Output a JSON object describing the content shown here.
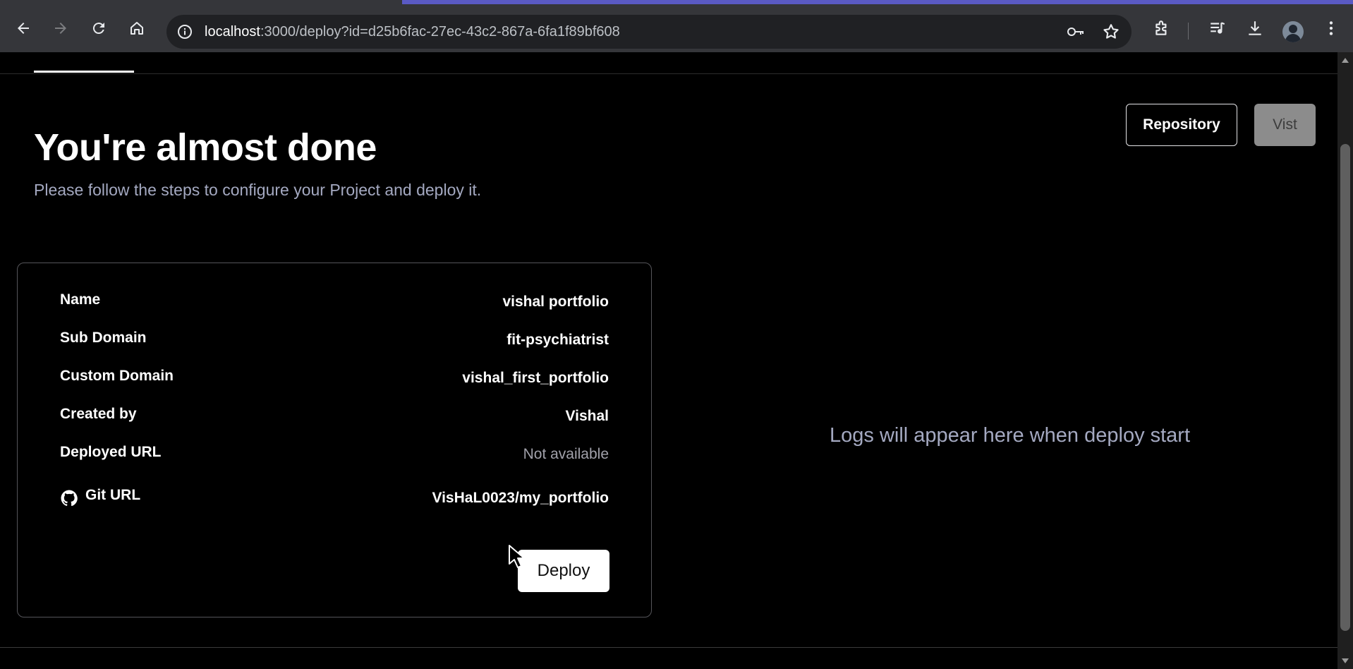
{
  "browser": {
    "url_host": "localhost",
    "url_rest": ":3000/deploy?id=d25b6fac-27ec-43c2-867a-6fa1f89bf608",
    "icons": [
      "back-arrow-icon",
      "forward-arrow-icon",
      "reload-icon",
      "home-icon",
      "site-info-icon",
      "password-key-icon",
      "bookmark-star-icon",
      "extensions-puzzle-icon",
      "media-queue-icon",
      "download-icon",
      "profile-avatar",
      "more-menu-icon"
    ]
  },
  "header": {
    "title": "You're almost done",
    "subtitle": "Please follow the steps to configure your Project and deploy it."
  },
  "actions": {
    "repository_label": "Repository",
    "visit_label": "Vist"
  },
  "project": {
    "rows": [
      {
        "label": "Name",
        "value": "vishal portfolio"
      },
      {
        "label": "Sub Domain",
        "value": "fit-psychiatrist"
      },
      {
        "label": "Custom Domain",
        "value": "vishal_first_portfolio"
      },
      {
        "label": "Created by",
        "value": "Vishal"
      },
      {
        "label": "Deployed URL",
        "value": "Not available"
      },
      {
        "label": "Git URL",
        "value": "VisHaL0023/my_portfolio"
      }
    ],
    "deploy_label": "Deploy"
  },
  "logs": {
    "empty_message": "Logs will appear here when deploy start"
  },
  "colors": {
    "background": "#000000",
    "muted_text": "#a4a9c1",
    "disabled_button": "#8c8c8c",
    "browser_chrome": "#35363a"
  }
}
